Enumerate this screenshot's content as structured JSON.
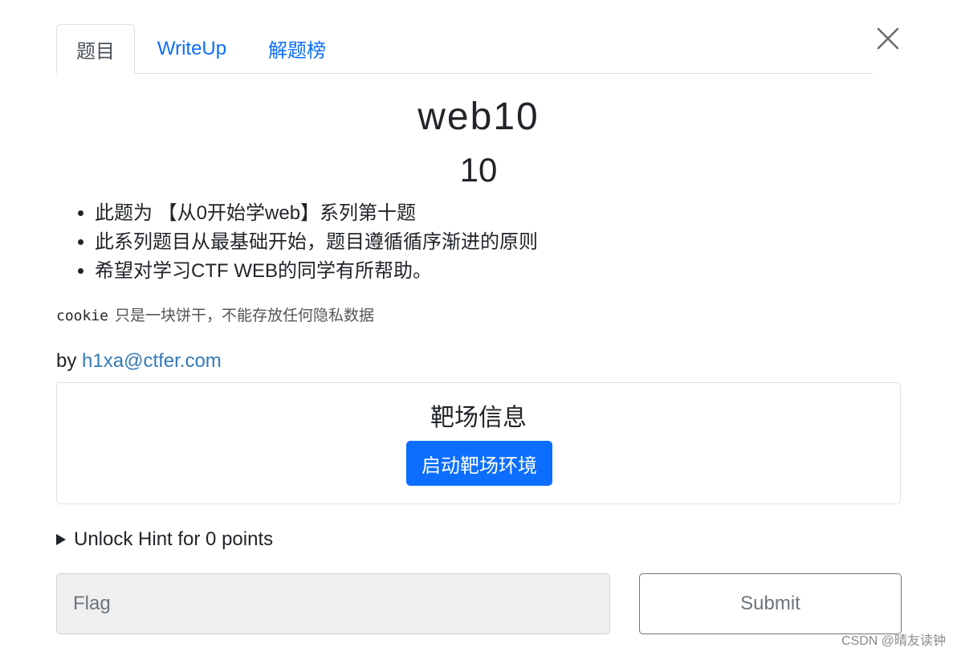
{
  "tabs": [
    {
      "label": "题目",
      "active": true
    },
    {
      "label": "WriteUp",
      "active": false
    },
    {
      "label": "解题榜",
      "active": false
    }
  ],
  "challenge": {
    "name": "web10",
    "points": "10",
    "description": [
      "此题为 【从0开始学web】系列第十题",
      "此系列题目从最基础开始，题目遵循循序渐进的原则",
      "希望对学习CTF WEB的同学有所帮助。"
    ],
    "note_code": "cookie",
    "note_text": "只是一块饼干，不能存放任何隐私数据",
    "author_prefix": "by",
    "author_email": "h1xa@ctfer.com"
  },
  "target": {
    "title": "靶场信息",
    "start_button": "启动靶场环境"
  },
  "hint": {
    "label": "Unlock Hint for 0 points"
  },
  "flag_form": {
    "placeholder": "Flag",
    "submit_label": "Submit"
  },
  "watermark": "CSDN @晴友读钟",
  "colors": {
    "link": "#0d6efd",
    "primary_button": "#0d6efd",
    "author_link": "#337ab7"
  }
}
